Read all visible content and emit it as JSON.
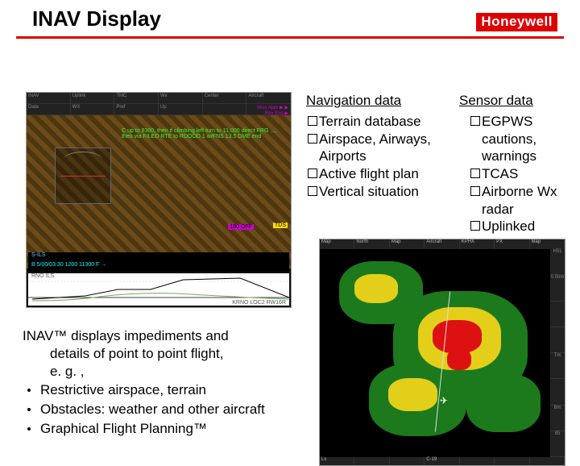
{
  "header": {
    "title": "INAV Display",
    "brand": "Honeywell"
  },
  "nav": {
    "heading": "Navigation data",
    "items": [
      "Terrain database",
      "Airspace, Airways, Airports",
      "Active flight plan",
      "Vertical situation"
    ]
  },
  "sensor": {
    "heading": "Sensor data",
    "items": [
      "EGPWS cautions, warnings",
      "TCAS",
      "Airborne Wx radar",
      "Uplinked weather"
    ]
  },
  "summary": {
    "lead_l1": "INAV™ displays impediments and",
    "lead_l2": "details of point to point flight,",
    "lead_l3": "e. g. ,",
    "bullets": [
      "Restrictive airspace, terrain",
      "Obstacles: weather and other aircraft",
      "Graphical Flight Planning™"
    ]
  },
  "cockpit": {
    "menu": [
      "INAV",
      "Uplink",
      "TMC",
      "Wx",
      "Center",
      "Aircraft"
    ],
    "sub": [
      "Data",
      "WX",
      "Pref",
      "Up",
      "",
      ""
    ],
    "green_text": "C up to 8300, then if climbing left turn to 11,000 direct FRG ..., then via FILED RTE to RDOOD 1 w/FNS 13.5 DME end",
    "band_top": "S-ILS",
    "band_bot": "B  5/00/03.30 1200 11300 F →",
    "right_tag": "TDS",
    "mag_tag": "180 OFF",
    "profile_l": "RNO ILS",
    "profile_r": "KRNO LOC2 RW16R",
    "miss": "Miss Appr ▶ ▶ Rev  Eng ▶"
  },
  "wx": {
    "top": [
      "Map",
      "North",
      "Map",
      "Aircraft",
      "KPHX",
      "PX",
      "Map"
    ],
    "bot": [
      "Lx",
      "",
      "",
      "C-19",
      "",
      "",
      ""
    ],
    "side": [
      "H51",
      "0.0nm",
      "",
      "",
      "Trk",
      "",
      "Bm",
      "85"
    ]
  }
}
